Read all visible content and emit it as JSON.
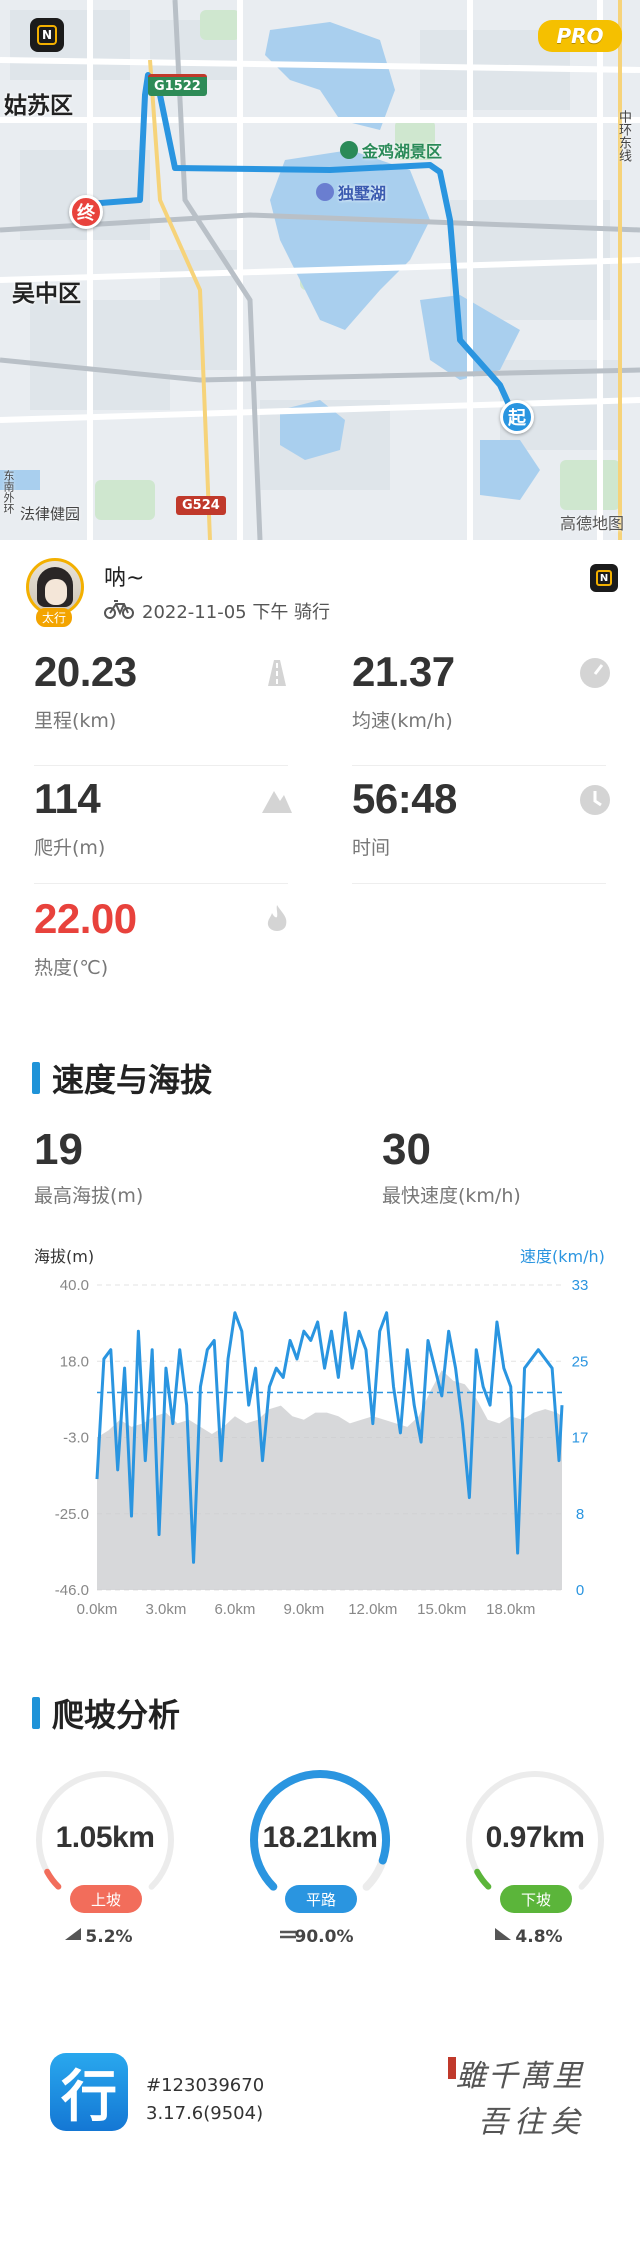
{
  "map": {
    "labels": {
      "gusu": "姑苏区",
      "wuzhong": "吴中区",
      "jinji_scenic": "金鸡湖景区",
      "dushu_lake": "独墅湖",
      "zhonghuan": "中环东线",
      "law_school": "法律健园",
      "left_edge": "东南外环"
    },
    "roads": {
      "g1522": "G1522",
      "g524": "G524"
    },
    "start_marker": "起",
    "end_marker": "终",
    "pro_badge": "PRO",
    "attribution": "高德地图",
    "route_color": "#2a95e0"
  },
  "user": {
    "name": "呐~",
    "avatar_tag": "太行",
    "ride_meta": "2022-11-05 下午 骑行"
  },
  "stats": {
    "distance": {
      "value": "20.23",
      "label": "里程(km)",
      "icon": "road-icon"
    },
    "avg_speed": {
      "value": "21.37",
      "label": "均速(km/h)",
      "icon": "speedometer-icon"
    },
    "climb": {
      "value": "114",
      "label": "爬升(m)",
      "icon": "mountain-icon"
    },
    "time": {
      "value": "56:48",
      "label": "时间",
      "icon": "clock-icon"
    },
    "calories": {
      "value": "22.00",
      "label": "热度(℃)",
      "icon": "flame-icon",
      "color": "#e8423c"
    }
  },
  "speed_section": {
    "title": "速度与海拔",
    "max_altitude": {
      "value": "19",
      "label": "最高海拔(m)"
    },
    "max_speed": {
      "value": "30",
      "label": "最快速度(km/h)"
    }
  },
  "chart_data": {
    "type": "line",
    "left_axis_title": "海拔(m)",
    "right_axis_title": "速度(km/h)",
    "x_ticks": [
      "0.0km",
      "3.0km",
      "6.0km",
      "9.0km",
      "12.0km",
      "15.0km",
      "18.0km"
    ],
    "left_ticks": [
      "40.0",
      "18.0",
      "-3.0",
      "-25.0",
      "-46.0"
    ],
    "right_ticks": [
      "33",
      "25",
      "17",
      "8",
      "0"
    ],
    "xlim": [
      0,
      20.23
    ],
    "altitude_ylim": [
      -46,
      40
    ],
    "speed_ylim": [
      0,
      33
    ],
    "avg_speed": 21.37,
    "series": [
      {
        "name": "海拔(m)",
        "color": "#c9cbce",
        "x": [
          0,
          0.5,
          1,
          1.5,
          2,
          2.5,
          3,
          3.5,
          4,
          4.5,
          5,
          5.5,
          6,
          6.5,
          7,
          7.5,
          8,
          8.5,
          9,
          9.5,
          10,
          10.5,
          11,
          11.5,
          12,
          12.5,
          13,
          13.5,
          14,
          14.5,
          15,
          15.5,
          16,
          16.5,
          17,
          17.5,
          18,
          18.5,
          19,
          19.5,
          20,
          20.23
        ],
        "values": [
          -3,
          -1,
          2,
          0,
          1,
          3,
          4,
          1,
          2,
          0,
          -2,
          0,
          3,
          1,
          2,
          5,
          6,
          3,
          2,
          4,
          4,
          3,
          1,
          2,
          3,
          2,
          1,
          0,
          3,
          10,
          16,
          13,
          12,
          8,
          2,
          1,
          3,
          2,
          4,
          5,
          4,
          3
        ]
      },
      {
        "name": "速度(km/h)",
        "color": "#2a95e0",
        "x": [
          0,
          0.3,
          0.6,
          0.9,
          1.2,
          1.5,
          1.8,
          2.1,
          2.4,
          2.7,
          3.0,
          3.3,
          3.6,
          3.9,
          4.2,
          4.5,
          4.8,
          5.1,
          5.4,
          5.7,
          6.0,
          6.3,
          6.6,
          6.9,
          7.2,
          7.5,
          7.8,
          8.1,
          8.4,
          8.7,
          9.0,
          9.3,
          9.6,
          9.9,
          10.2,
          10.5,
          10.8,
          11.1,
          11.4,
          11.7,
          12.0,
          12.3,
          12.6,
          12.9,
          13.2,
          13.5,
          13.8,
          14.1,
          14.4,
          14.7,
          15.0,
          15.3,
          15.6,
          15.9,
          16.2,
          16.5,
          16.8,
          17.1,
          17.4,
          17.7,
          18.0,
          18.3,
          18.6,
          18.9,
          19.2,
          19.5,
          19.8,
          20.1,
          20.23
        ],
        "values": [
          12,
          25,
          26,
          13,
          24,
          8,
          28,
          14,
          26,
          6,
          24,
          18,
          26,
          20,
          3,
          22,
          26,
          27,
          14,
          25,
          30,
          28,
          20,
          24,
          14,
          22,
          24,
          23,
          27,
          25,
          28,
          27,
          29,
          24,
          28,
          23,
          30,
          24,
          28,
          26,
          18,
          28,
          30,
          22,
          17,
          26,
          20,
          16,
          27,
          24,
          21,
          28,
          24,
          18,
          10,
          26,
          22,
          20,
          29,
          24,
          22,
          4,
          24,
          25,
          26,
          25,
          24,
          14,
          20
        ]
      }
    ]
  },
  "climb_section": {
    "title": "爬坡分析",
    "uphill": {
      "distance": "1.05km",
      "label": "上坡",
      "pct": "5.2%",
      "color": "#f26d5b",
      "fraction": 0.052
    },
    "flat": {
      "distance": "18.21km",
      "label": "平路",
      "pct": "90.0%",
      "color": "#2a95e0",
      "fraction": 0.9
    },
    "downhill": {
      "distance": "0.97km",
      "label": "下坡",
      "pct": "4.8%",
      "color": "#5bb53a",
      "fraction": 0.048
    }
  },
  "footer": {
    "app_logo_char": "行",
    "record_id": "#123039670",
    "version": "3.17.6(9504)",
    "calligraphy_line1": "雖千萬里",
    "calligraphy_line2": "吾往矣"
  }
}
